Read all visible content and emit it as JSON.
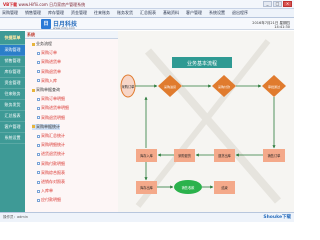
{
  "window": {
    "title_prefix": "VB下载",
    "title_url": "www.Hiflii.com",
    "title_suffix": "日月家房产管理系统",
    "controls": [
      "_",
      "□",
      "×"
    ]
  },
  "menu": [
    "采购管理",
    "销售管理",
    "库存管理",
    "资金管理",
    "往来账务",
    "账务发货",
    "汇总报表",
    "基础资料",
    "客户管理",
    "系统设置",
    "退出程序"
  ],
  "brand": {
    "logo_text": "日",
    "name": "日月科技",
    "url": "www.ririkj.com"
  },
  "datetime": {
    "date": "2016年7月21日 星期四",
    "time": "14:41:30"
  },
  "sidebar": {
    "header": "快捷菜单",
    "items": [
      "采购管理",
      "销售管理",
      "库存管理",
      "资金管理",
      "往来账务",
      "账务发货",
      "汇总报表",
      "客户管理",
      "系统设置"
    ],
    "active_index": 0
  },
  "tree": {
    "header": "系统",
    "nodes": [
      {
        "label": "业务流程",
        "type": "folder"
      },
      {
        "label": "采购订单",
        "type": "leaf"
      },
      {
        "label": "采购进货单",
        "type": "leaf"
      },
      {
        "label": "采购退货单",
        "type": "leaf"
      },
      {
        "label": "采购入库",
        "type": "leaf"
      },
      {
        "label": "采购单据查询",
        "type": "folder"
      },
      {
        "label": "采购订单明细",
        "type": "leaf"
      },
      {
        "label": "采购进货单明细",
        "type": "leaf"
      },
      {
        "label": "采购退货明细",
        "type": "leaf"
      },
      {
        "label": "采购单据统计",
        "type": "folder",
        "selected": true
      },
      {
        "label": "采购汇总统计",
        "type": "leaf"
      },
      {
        "label": "采购明细统计",
        "type": "leaf"
      },
      {
        "label": "进货退货统计",
        "type": "leaf"
      },
      {
        "label": "采购付款明细",
        "type": "leaf"
      },
      {
        "label": "采购综合报表",
        "type": "leaf"
      },
      {
        "label": "进销存对照表",
        "type": "leaf"
      },
      {
        "label": "入库单",
        "type": "leaf"
      },
      {
        "label": "应付款明细",
        "type": "leaf"
      }
    ]
  },
  "flow": {
    "title": "业务基本流程",
    "nodes": [
      "采购订单",
      "采购进货",
      "采购付款",
      "审批通过",
      "库存入库",
      "采购退货",
      "退货出库",
      "销售订单",
      "库存出库",
      "销售收款",
      "结束"
    ]
  },
  "colors": {
    "sidebar": "#3e9a96",
    "diamond": "#e07b2e",
    "box": "#f4a98a",
    "accent": "#2b6fbe"
  },
  "status": {
    "text": "操作员：admin",
    "watermark": "Shouke下载"
  }
}
